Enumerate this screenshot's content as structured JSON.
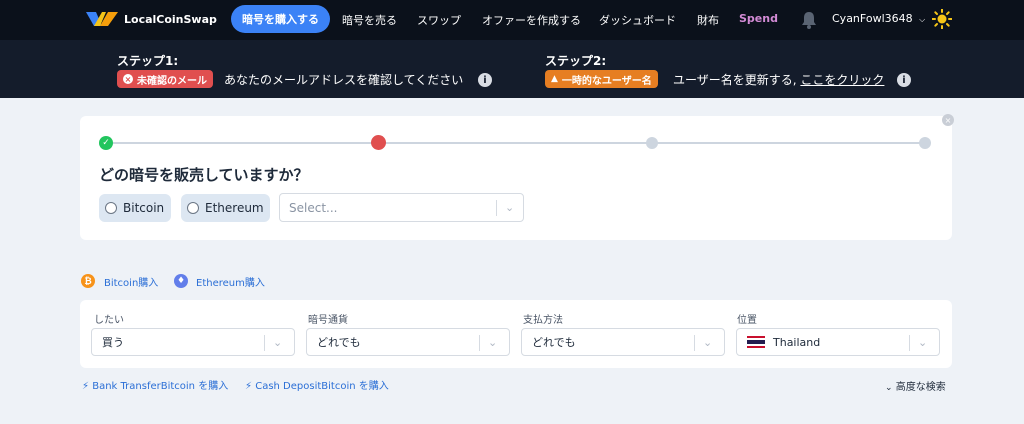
{
  "header": {
    "brand": "LocalCoinSwap",
    "nav_active": "暗号を購入する",
    "nav": [
      "暗号を売る",
      "スワップ",
      "オファーを作成する",
      "ダッシュボード",
      "財布"
    ],
    "spend": "Spend",
    "username": "CyanFowl3648",
    "icons": [
      "logo-icon",
      "bell-icon",
      "chevron-down-icon",
      "sun-icon"
    ]
  },
  "steps": {
    "step1": {
      "title": "ステップ1:",
      "badge": "未確認のメール",
      "text": "あなたのメールアドレスを確認してください"
    },
    "step2": {
      "title": "ステップ2:",
      "badge": "一時的なユーザー名",
      "text": "ユーザー名を更新する,",
      "link": "ここをクリック"
    },
    "info_glyph": "i"
  },
  "wizard": {
    "question": "どの暗号を販売していますか？",
    "options": [
      "Bitcoin",
      "Ethereum"
    ],
    "select_placeholder": "Select...",
    "progress": {
      "current_step": 2,
      "total_steps": 4
    }
  },
  "buy_links": {
    "bitcoin": "Bitcoin購入",
    "ethereum": "Ethereum購入"
  },
  "filters": {
    "want": {
      "label": "したい",
      "value": "買う"
    },
    "crypto": {
      "label": "暗号通貨",
      "value": "どれでも"
    },
    "payment": {
      "label": "支払方法",
      "value": "どれでも"
    },
    "location": {
      "label": "位置",
      "value": "Thailand"
    }
  },
  "quick_links": [
    "Bank TransferBitcoin を購入",
    "Cash DepositBitcoin を購入"
  ],
  "advanced_search": "高度な検索",
  "colors": {
    "accent": "#3b82f6",
    "header_bg": "#0b111b",
    "banner_bg": "#141c2b",
    "success": "#22c55e",
    "current": "#e04f4f",
    "pending": "#cdd5df"
  }
}
